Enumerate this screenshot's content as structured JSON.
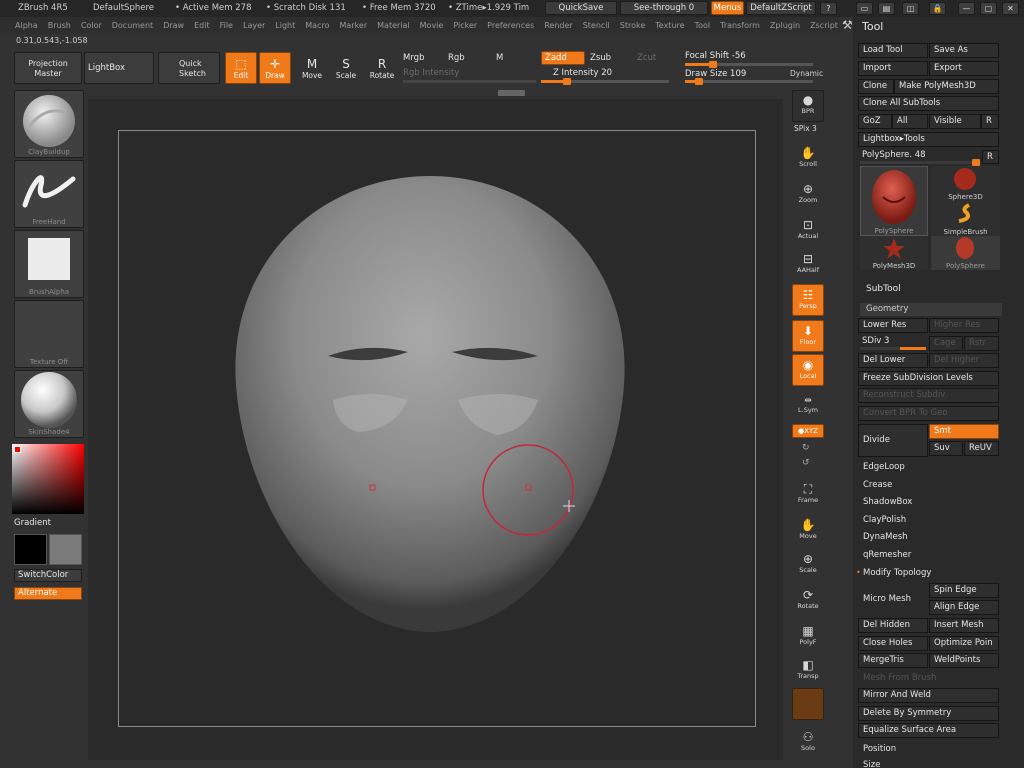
{
  "titlebar": {
    "app": "ZBrush 4R5",
    "document": "DefaultSphere",
    "active_mem": "• Active Mem 278",
    "scratch_disk": "• Scratch Disk 131",
    "free_mem": "• Free Mem 3720",
    "ztime": "• ZTime▸1.929 Tim",
    "quicksave": "QuickSave",
    "see_through": "See-through  0",
    "menus": "Menus",
    "script": "DefaultZScript",
    "icons": [
      "?",
      "▭",
      "▤",
      "◫",
      "🔒",
      "—",
      "▢",
      "✕"
    ]
  },
  "menubar": [
    "Alpha",
    "Brush",
    "Color",
    "Document",
    "Draw",
    "Edit",
    "File",
    "Layer",
    "Light",
    "Macro",
    "Marker",
    "Material",
    "Movie",
    "Picker",
    "Preferences",
    "Render",
    "Stencil",
    "Stroke",
    "Texture",
    "Tool",
    "Transform",
    "Zplugin",
    "Zscript"
  ],
  "coords": "0.31,0.543,-1.058",
  "toolbar": {
    "projection_master": "Projection Master",
    "lightbox": "LightBox",
    "quick_sketch": "Quick Sketch",
    "edit": "Edit",
    "draw": "Draw",
    "move": "Move",
    "scale": "Scale",
    "rotate": "Rotate",
    "mrgb": "Mrgb",
    "rgb": "Rgb",
    "m": "M",
    "rgb_intensity": "Rgb Intensity",
    "zadd": "Zadd",
    "zsub": "Zsub",
    "zcut": "Zcut",
    "z_intensity": "Z Intensity 20",
    "focal_shift": "Focal Shift -56",
    "draw_size": "Draw Size 109",
    "dynamic": "Dynamic",
    "z_intensity_value": 20,
    "z_intensity_max": 100,
    "focal_shift_value": -56,
    "focal_shift_min": -100,
    "focal_shift_max": 100,
    "draw_size_value": 109,
    "draw_size_max": 1000
  },
  "leftpanel": {
    "brush": "ClayBuildup",
    "stroke": "FreeHand",
    "alpha": "BrushAlpha",
    "texture": "Texture Off",
    "material": "SkinShade4",
    "gradient": "Gradient",
    "switch_color": "SwitchColor",
    "alternate": "Alternate"
  },
  "rightshelf": {
    "bpr": "BPR",
    "spix": "SPix 3",
    "scroll": "Scroll",
    "zoom": "Zoom",
    "actual": "Actual",
    "aahalf": "AAHalf",
    "persp": "Persp",
    "floor": "Floor",
    "local": "Local",
    "lsym": "L.Sym",
    "xyz": "●XYZ",
    "frame": "Frame",
    "move": "Move",
    "scale": "Scale",
    "rotate": "Rotate",
    "polyf": "PolyF",
    "transp": "Transp",
    "solo": "Solo"
  },
  "toolpanel": {
    "title": "Tool",
    "load_tool": "Load Tool",
    "save_as": "Save As",
    "import": "Import",
    "export": "Export",
    "clone": "Clone",
    "make_polymesh": "Make PolyMesh3D",
    "clone_all": "Clone All SubTools",
    "goz": "GoZ",
    "all": "All",
    "visible": "Visible",
    "r": "R",
    "lightbox_tools": "Lightbox▸Tools",
    "polysphere": "PolySphere. 48",
    "tiles": {
      "polysphere_main": "PolySphere",
      "sphere3d": "Sphere3D",
      "simplebrush": "SimpleBrush",
      "polymesh3d": "PolyMesh3D",
      "polysphere_small": "PolySphere"
    },
    "subtool": "SubTool",
    "geometry": "Geometry",
    "lower_res": "Lower Res",
    "higher_res": "Higher Res",
    "sdiv": "SDiv 3",
    "cage": "Cage",
    "rstr": "Rstr",
    "del_lower": "Del Lower",
    "del_higher": "Del Higher",
    "freeze": "Freeze SubDivision Levels",
    "reconstruct": "Reconstruct Subdiv",
    "convert_bpr": "Convert BPR To Geo",
    "divide": "Divide",
    "smt": "Smt",
    "suv": "Suv",
    "reuv": "ReUV",
    "edgeloop": "EdgeLoop",
    "crease": "Crease",
    "shadowbox": "ShadowBox",
    "claypolish": "ClayPolish",
    "dynamesh": "DynaMesh",
    "qremesher": "qRemesher",
    "modify_topology": "Modify Topology",
    "micro_mesh": "Micro Mesh",
    "spin_edge": "Spin Edge",
    "align_edge": "Align Edge",
    "del_hidden": "Del Hidden",
    "insert_mesh": "Insert Mesh",
    "close_holes": "Close Holes",
    "optimize_points": "Optimize Poin",
    "mergetris": "MergeTris",
    "weldpoints": "WeldPoints",
    "mesh_from_brush": "Mesh From Brush",
    "mirror_weld": "Mirror And Weld",
    "delete_symmetry": "Delete By Symmetry",
    "equalize": "Equalize Surface Area",
    "position": "Position",
    "size": "Size"
  }
}
